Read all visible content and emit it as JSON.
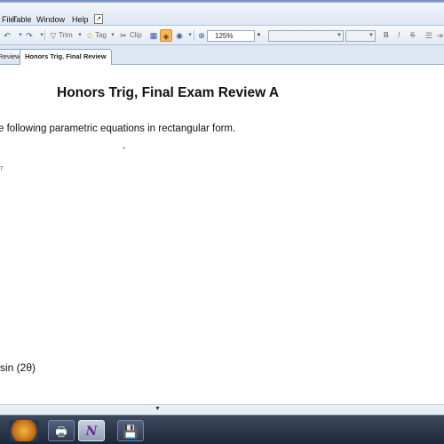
{
  "menu": {
    "items": [
      "File",
      "Table",
      "Window",
      "Help"
    ]
  },
  "toolbar": {
    "undo_icon": "undo-icon",
    "redo_icon": "redo-icon",
    "tools": [
      "Trim",
      "Tag",
      "Clip"
    ],
    "zoom_value": "125%",
    "style_value": "",
    "size_value": "",
    "format_labels": [
      "B",
      "I",
      "S"
    ]
  },
  "tabs": [
    {
      "label": "Review",
      "active": false
    },
    {
      "label": "Honors Trig. Final Review",
      "active": true
    }
  ],
  "document": {
    "title": "Honors Trig, Final Exam Review A",
    "instruction": "e following parametric equations in rectangular form.",
    "small_mark": "7",
    "equation": "sin (2θ)"
  },
  "taskbar": {
    "buttons": [
      "start-orb",
      "fax-app",
      "onenote-app",
      "save-app"
    ]
  },
  "colors": {
    "highlight": "#f5b85a",
    "taskbar": "#2a3548",
    "tab_strip": "#dfe7f2"
  }
}
